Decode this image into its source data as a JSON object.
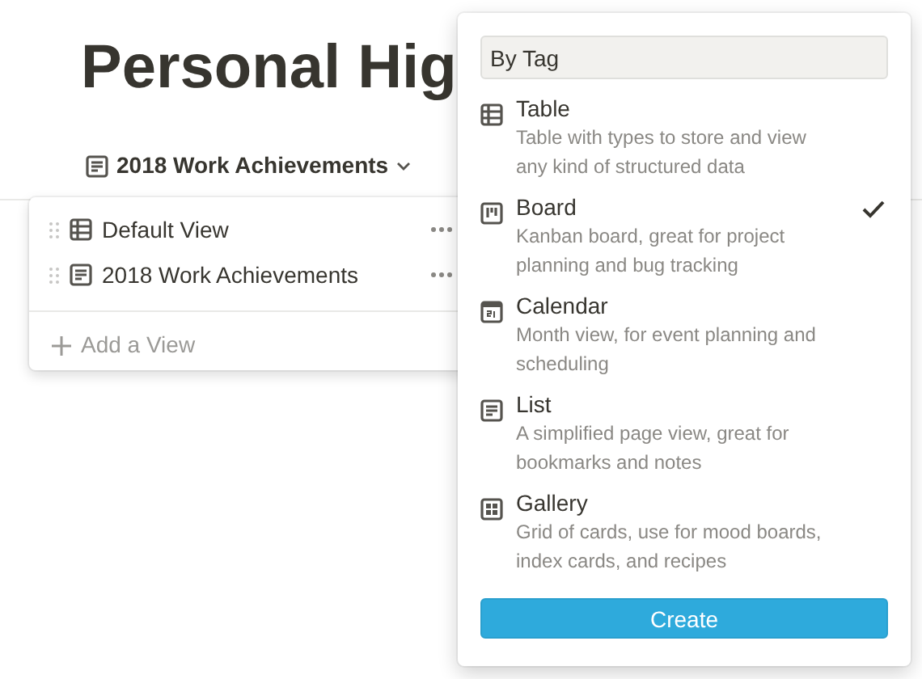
{
  "page": {
    "title": "Personal Hig"
  },
  "view_selector": {
    "label": "2018 Work Achievements",
    "kind": "list"
  },
  "views_menu": {
    "items": [
      {
        "label": "Default View",
        "kind": "table"
      },
      {
        "label": "2018 Work Achievements",
        "kind": "list"
      }
    ],
    "add_label": "Add a View"
  },
  "new_view_popup": {
    "name_field": {
      "value": "By Tag"
    },
    "types": [
      {
        "kind": "table",
        "title": "Table",
        "description": "Table with types to store and view any kind of structured data",
        "selected": false
      },
      {
        "kind": "board",
        "title": "Board",
        "description": "Kanban board, great for project planning and bug tracking",
        "selected": true
      },
      {
        "kind": "calendar",
        "title": "Calendar",
        "description": "Month view, for event planning and scheduling",
        "selected": false
      },
      {
        "kind": "list",
        "title": "List",
        "description": "A simplified page view, great for bookmarks and notes",
        "selected": false
      },
      {
        "kind": "gallery",
        "title": "Gallery",
        "description": "Grid of cards, use for mood boards, index cards, and recipes",
        "selected": false
      }
    ],
    "create_button": "Create"
  }
}
